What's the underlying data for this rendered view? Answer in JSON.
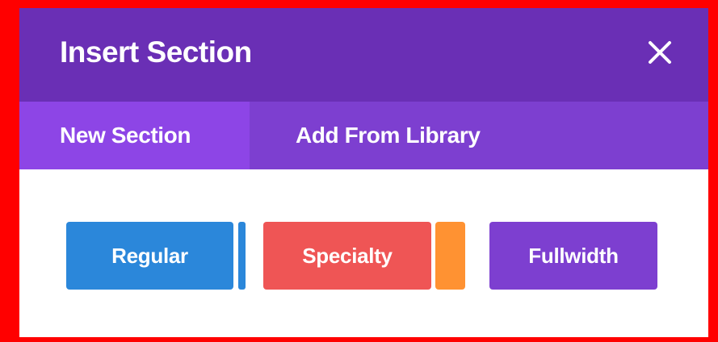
{
  "modal": {
    "title": "Insert Section",
    "close_icon": "close-icon"
  },
  "tabs": [
    {
      "label": "New Section",
      "active": true
    },
    {
      "label": "Add From Library",
      "active": false
    }
  ],
  "section_types": [
    {
      "label": "Regular",
      "color": "#2b87da",
      "accent_color": "#2b87da"
    },
    {
      "label": "Specialty",
      "color": "#ef5555",
      "accent_color": "#ff9232"
    },
    {
      "label": "Fullwidth",
      "color": "#7d3fd0"
    }
  ],
  "colors": {
    "header": "#6a2fb5",
    "tabbar": "#7d3fd0",
    "active_tab": "#8d45e6",
    "highlight_border": "#ff0000"
  }
}
